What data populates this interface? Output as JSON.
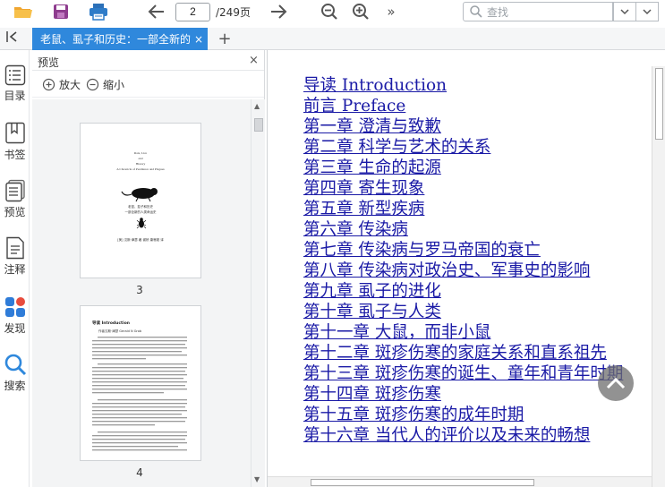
{
  "toolbar": {
    "page_value": "2",
    "page_total": "/249页",
    "search_placeholder": "查找",
    "icons": [
      "open-folder-icon",
      "save-icon",
      "print-icon",
      "prev-page-icon",
      "next-page-icon",
      "zoom-out-icon",
      "zoom-in-icon",
      "more-icon",
      "search-prev-icon",
      "search-next-icon"
    ]
  },
  "tabs": [
    {
      "label": "老鼠、虱子和历史：一部全新的",
      "close": "×"
    }
  ],
  "tab_add": "+",
  "rail": [
    {
      "label": "目录",
      "icon": "toc-icon"
    },
    {
      "label": "书签",
      "icon": "bookmark-icon"
    },
    {
      "label": "预览",
      "icon": "preview-icon"
    },
    {
      "label": "注释",
      "icon": "annotation-icon"
    },
    {
      "label": "发现",
      "icon": "discover-icon"
    },
    {
      "label": "搜索",
      "icon": "search-icon"
    }
  ],
  "preview": {
    "title": "预览",
    "close": "×",
    "zoom_in": "放大",
    "zoom_out": "缩小",
    "pages": [
      {
        "number": "3",
        "lines": [
          "Rats, Lice",
          "and",
          "History",
          "A Chronicle of Pestilence and Plagues",
          "老鼠、虱子和历史",
          "一部全新的人类命运史",
          "[美] 汉斯·津瑟 著  谢桥 康睿超 译"
        ]
      },
      {
        "number": "4",
        "lines": [
          "导读 Introduction",
          "作者汉斯·津瑟 Gerald N Grob"
        ]
      }
    ]
  },
  "document": {
    "toc": [
      "导读 Introduction",
      "前言 Preface",
      "第一章 澄清与致歉",
      "第二章 科学与艺术的关系",
      "第三章 生命的起源",
      "第四章 寄生现象",
      "第五章 新型疾病",
      "第六章 传染病",
      "第七章 传染病与罗马帝国的衰亡",
      "第八章 传染病对政治史、军事史的影响",
      "第九章 虱子的进化",
      "第十章 虱子与人类",
      "第十一章 大鼠，而非小鼠",
      "第十二章 斑疹伤寒的家庭关系和直系祖先",
      "第十三章 斑疹伤寒的诞生、童年和青年时期",
      "第十四章 斑疹伤寒",
      "第十五章 斑疹伤寒的成年时期",
      "第十六章 当代人的评价以及未来的畅想"
    ]
  },
  "colors": {
    "accent": "#2f88dc",
    "link": "#1a1aa6",
    "tab_text": "#ffffff"
  }
}
